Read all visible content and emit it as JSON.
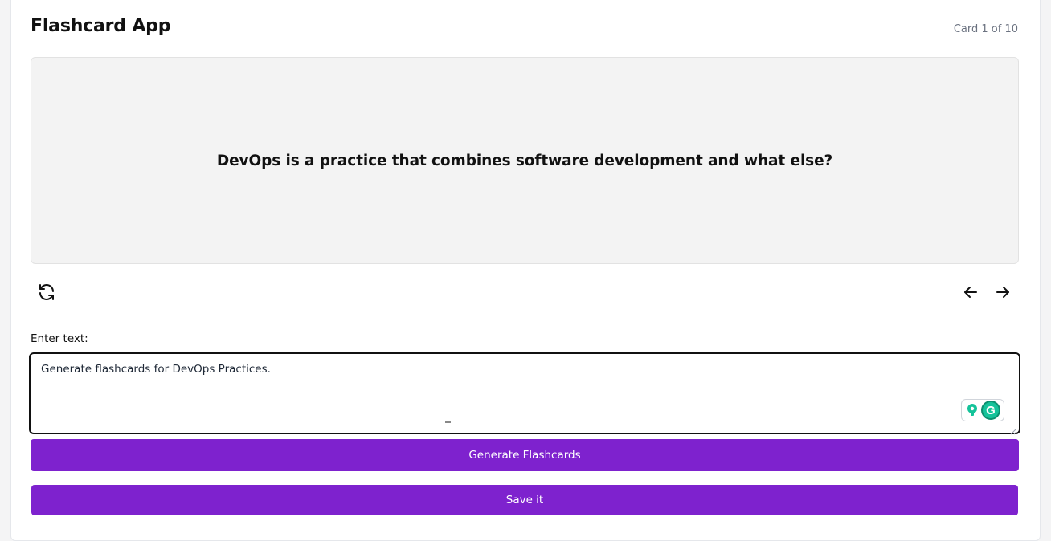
{
  "header": {
    "title": "Flashcard App",
    "counter": "Card 1 of 10"
  },
  "card": {
    "question": "DevOps is a practice that combines software development and what else?"
  },
  "controls": {
    "flip_icon": "refresh-icon",
    "prev_icon": "arrow-left-icon",
    "next_icon": "arrow-right-icon"
  },
  "input": {
    "label": "Enter text:",
    "value": "Generate flashcards for DevOps Practices."
  },
  "actions": {
    "generate_label": "Generate Flashcards",
    "save_label": "Save it"
  },
  "colors": {
    "accent": "#7e22ce",
    "card_bg": "#f3f3f3",
    "grammarly": "#15c39a"
  }
}
